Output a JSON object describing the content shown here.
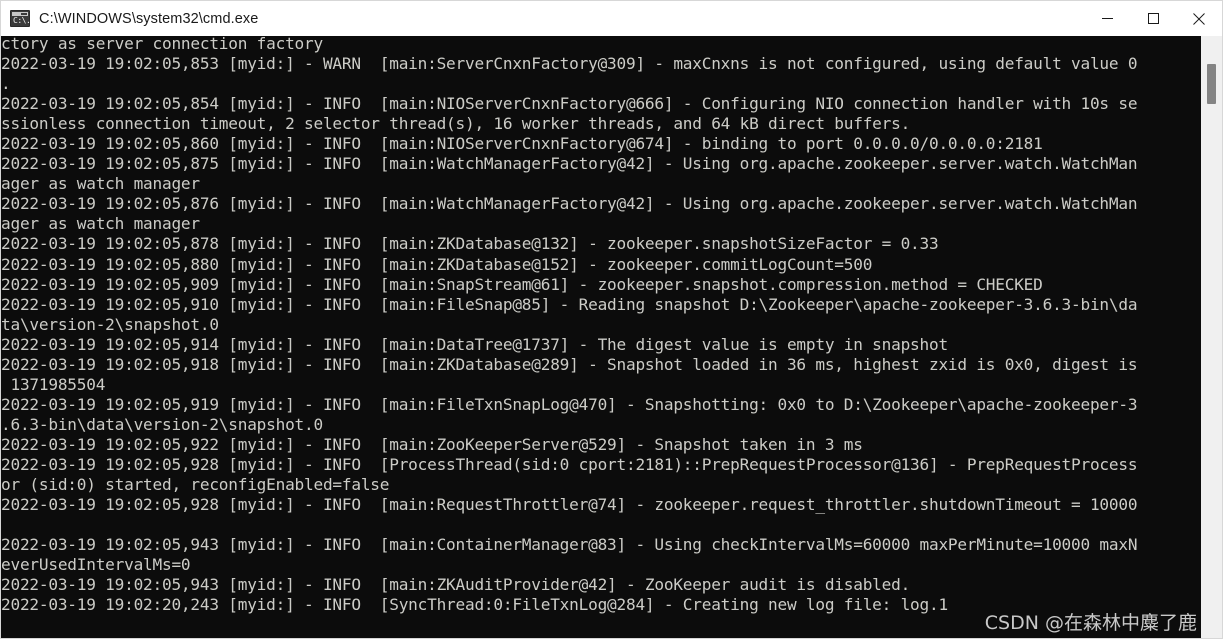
{
  "window": {
    "title": "C:\\WINDOWS\\system32\\cmd.exe",
    "icon": "cmd-icon",
    "icon_prompt": "C:\\.",
    "background_color": "#0c0c0c",
    "text_color": "#ccccc7",
    "controls": {
      "minimize_label": "Minimize",
      "maximize_label": "Maximize",
      "close_label": "Close"
    }
  },
  "scrollbar": {
    "name": "vertical-scrollbar",
    "thumb_name": "scrollbar-thumb"
  },
  "watermark": {
    "text": "CSDN @在森林中麋了鹿"
  },
  "console": {
    "lines": [
      "ctory as server connection factory",
      "2022-03-19 19:02:05,853 [myid:] - WARN  [main:ServerCnxnFactory@309] - maxCnxns is not configured, using default value 0",
      ".",
      "2022-03-19 19:02:05,854 [myid:] - INFO  [main:NIOServerCnxnFactory@666] - Configuring NIO connection handler with 10s se",
      "ssionless connection timeout, 2 selector thread(s), 16 worker threads, and 64 kB direct buffers.",
      "2022-03-19 19:02:05,860 [myid:] - INFO  [main:NIOServerCnxnFactory@674] - binding to port 0.0.0.0/0.0.0.0:2181",
      "2022-03-19 19:02:05,875 [myid:] - INFO  [main:WatchManagerFactory@42] - Using org.apache.zookeeper.server.watch.WatchMan",
      "ager as watch manager",
      "2022-03-19 19:02:05,876 [myid:] - INFO  [main:WatchManagerFactory@42] - Using org.apache.zookeeper.server.watch.WatchMan",
      "ager as watch manager",
      "2022-03-19 19:02:05,878 [myid:] - INFO  [main:ZKDatabase@132] - zookeeper.snapshotSizeFactor = 0.33",
      "2022-03-19 19:02:05,880 [myid:] - INFO  [main:ZKDatabase@152] - zookeeper.commitLogCount=500",
      "2022-03-19 19:02:05,909 [myid:] - INFO  [main:SnapStream@61] - zookeeper.snapshot.compression.method = CHECKED",
      "2022-03-19 19:02:05,910 [myid:] - INFO  [main:FileSnap@85] - Reading snapshot D:\\Zookeeper\\apache-zookeeper-3.6.3-bin\\da",
      "ta\\version-2\\snapshot.0",
      "2022-03-19 19:02:05,914 [myid:] - INFO  [main:DataTree@1737] - The digest value is empty in snapshot",
      "2022-03-19 19:02:05,918 [myid:] - INFO  [main:ZKDatabase@289] - Snapshot loaded in 36 ms, highest zxid is 0x0, digest is",
      " 1371985504",
      "2022-03-19 19:02:05,919 [myid:] - INFO  [main:FileTxnSnapLog@470] - Snapshotting: 0x0 to D:\\Zookeeper\\apache-zookeeper-3",
      ".6.3-bin\\data\\version-2\\snapshot.0",
      "2022-03-19 19:02:05,922 [myid:] - INFO  [main:ZooKeeperServer@529] - Snapshot taken in 3 ms",
      "2022-03-19 19:02:05,928 [myid:] - INFO  [ProcessThread(sid:0 cport:2181)::PrepRequestProcessor@136] - PrepRequestProcess",
      "or (sid:0) started, reconfigEnabled=false",
      "2022-03-19 19:02:05,928 [myid:] - INFO  [main:RequestThrottler@74] - zookeeper.request_throttler.shutdownTimeout = 10000",
      "",
      "2022-03-19 19:02:05,943 [myid:] - INFO  [main:ContainerManager@83] - Using checkIntervalMs=60000 maxPerMinute=10000 maxN",
      "everUsedIntervalMs=0",
      "2022-03-19 19:02:05,943 [myid:] - INFO  [main:ZKAuditProvider@42] - ZooKeeper audit is disabled.",
      "2022-03-19 19:02:20,243 [myid:] - INFO  [SyncThread:0:FileTxnLog@284] - Creating new log file: log.1"
    ]
  }
}
